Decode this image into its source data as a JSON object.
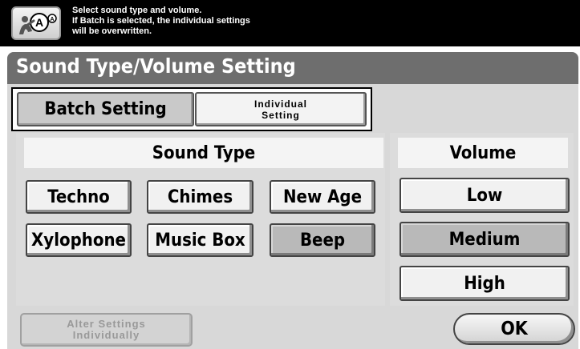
{
  "message": {
    "lines": [
      "Select sound type and volume.",
      "If Batch is selected, the individual settings",
      "will be overwritten."
    ]
  },
  "page_title": "Sound Type/Volume Setting",
  "tabs": {
    "batch": "Batch Setting",
    "individual_line1": "Individual",
    "individual_line2": "Setting",
    "selected": "batch"
  },
  "sound_type": {
    "header": "Sound Type",
    "options": [
      "Techno",
      "Chimes",
      "New Age",
      "Xylophone",
      "Music Box",
      "Beep"
    ],
    "selected": "Beep"
  },
  "volume": {
    "header": "Volume",
    "options": [
      "Low",
      "Medium",
      "High"
    ],
    "selected": "Medium"
  },
  "alter_button": {
    "line1": "Alter Settings",
    "line2": "Individually",
    "enabled": false
  },
  "ok_button": "OK",
  "colors": {
    "message_bar": "#000000",
    "title_band": "#6e6e6e",
    "panel": "#d8d8d8",
    "selected_button": "#b9b9b9",
    "button": "#f1f1f1"
  },
  "icons": {
    "help": "help-person-icon"
  }
}
